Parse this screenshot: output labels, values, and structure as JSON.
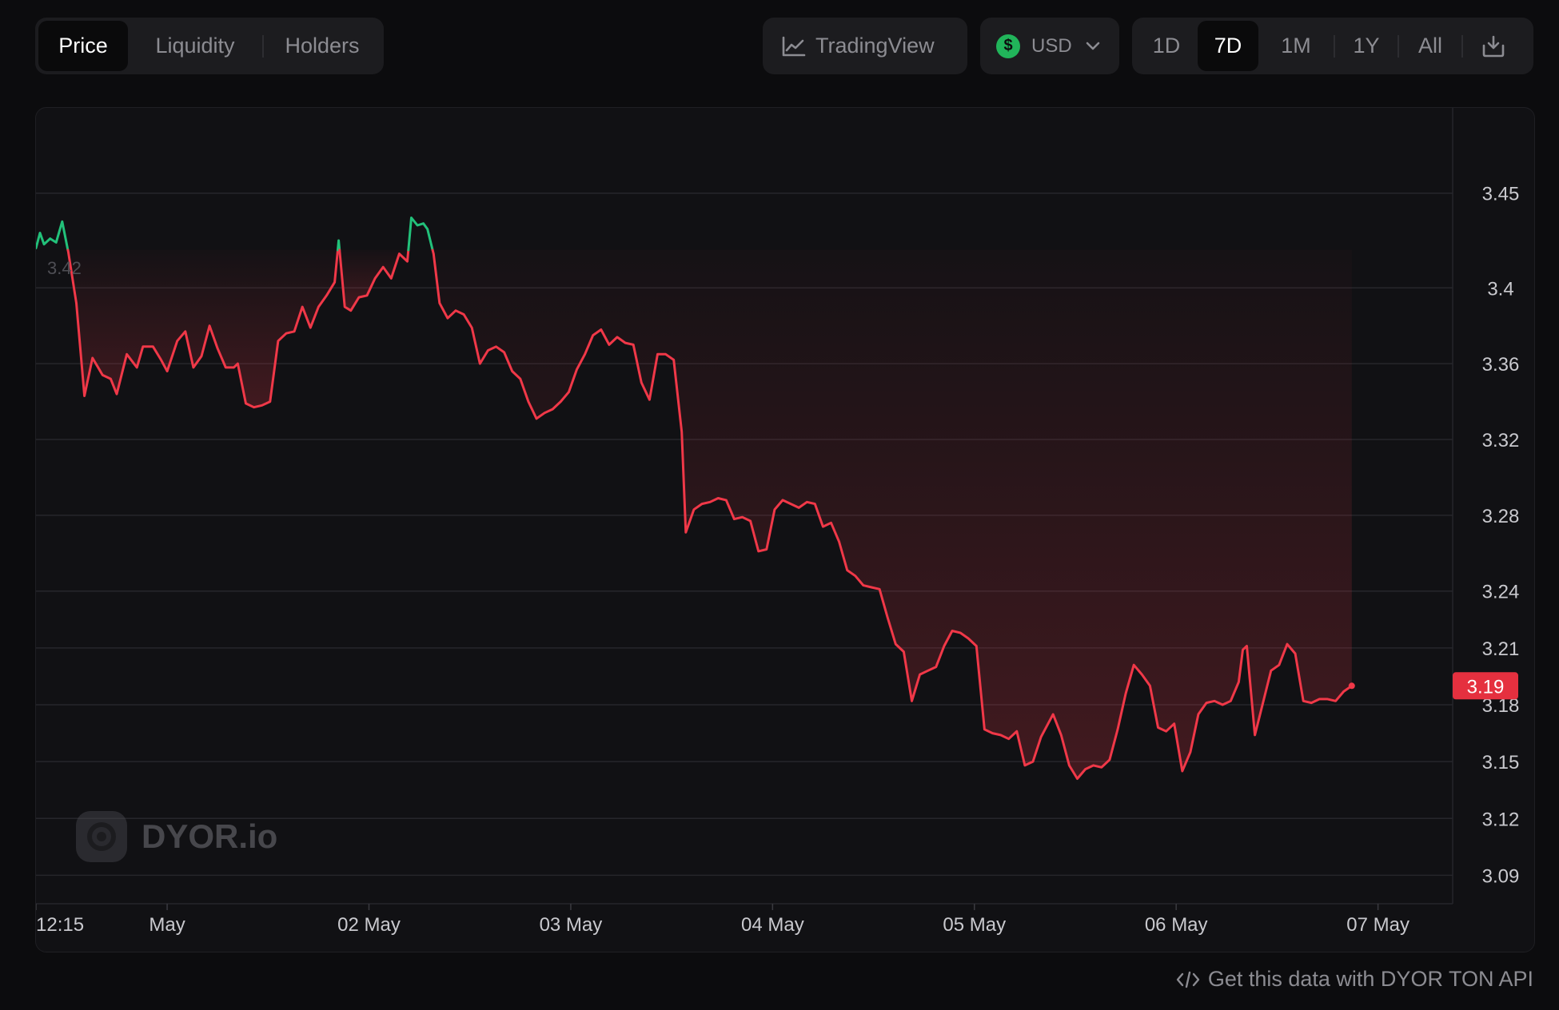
{
  "tabs": [
    {
      "label": "Price",
      "active": true
    },
    {
      "label": "Liquidity",
      "active": false
    },
    {
      "label": "Holders",
      "active": false
    }
  ],
  "tradingview": {
    "label": "TradingView",
    "icon": "line-chart-icon"
  },
  "currency": {
    "label": "USD",
    "icon": "dollar-icon",
    "symbol": "$",
    "chevron": "chevron-down-icon"
  },
  "ranges": [
    {
      "label": "1D",
      "active": false
    },
    {
      "label": "7D",
      "active": true
    },
    {
      "label": "1M",
      "active": false
    },
    {
      "label": "1Y",
      "active": false
    },
    {
      "label": "All",
      "active": false
    }
  ],
  "download": {
    "icon": "download-icon"
  },
  "watermark": {
    "text": "DYOR.io",
    "icon": "dyor-logo-icon"
  },
  "footer": {
    "text": "Get this data with DYOR TON API",
    "icon": "code-icon"
  },
  "colors": {
    "up": "#22c17a",
    "down": "#f03848",
    "badge": "#e5303f",
    "grid": "#26262b"
  },
  "chart_data": {
    "type": "area",
    "baseline": 3.42,
    "baseline_label": "3.42",
    "current": 3.19,
    "current_label": "3.19",
    "ylim": [
      3.075,
      3.495
    ],
    "yticks": [
      "3.45",
      "3.4",
      "3.36",
      "3.32",
      "3.28",
      "3.24",
      "3.21",
      "3.18",
      "3.15",
      "3.12",
      "3.09"
    ],
    "xticks": [
      {
        "t": 0,
        "label": "12:15"
      },
      {
        "t": 0.65,
        "label": "May"
      },
      {
        "t": 1.65,
        "label": "02 May"
      },
      {
        "t": 2.65,
        "label": "03 May"
      },
      {
        "t": 3.65,
        "label": "04 May"
      },
      {
        "t": 4.65,
        "label": "05 May"
      },
      {
        "t": 5.65,
        "label": "06 May"
      },
      {
        "t": 6.65,
        "label": "07 May"
      }
    ],
    "xlim": [
      0,
      7.02
    ],
    "points": [
      [
        0.0,
        3.421
      ],
      [
        0.02,
        3.429
      ],
      [
        0.04,
        3.423
      ],
      [
        0.07,
        3.426
      ],
      [
        0.1,
        3.424
      ],
      [
        0.13,
        3.435
      ],
      [
        0.16,
        3.419
      ],
      [
        0.2,
        3.392
      ],
      [
        0.24,
        3.343
      ],
      [
        0.28,
        3.363
      ],
      [
        0.33,
        3.354
      ],
      [
        0.37,
        3.352
      ],
      [
        0.4,
        3.344
      ],
      [
        0.45,
        3.365
      ],
      [
        0.5,
        3.358
      ],
      [
        0.53,
        3.369
      ],
      [
        0.58,
        3.369
      ],
      [
        0.62,
        3.362
      ],
      [
        0.65,
        3.356
      ],
      [
        0.7,
        3.372
      ],
      [
        0.74,
        3.377
      ],
      [
        0.78,
        3.358
      ],
      [
        0.82,
        3.364
      ],
      [
        0.86,
        3.38
      ],
      [
        0.9,
        3.368
      ],
      [
        0.94,
        3.358
      ],
      [
        0.98,
        3.358
      ],
      [
        1.0,
        3.36
      ],
      [
        1.04,
        3.339
      ],
      [
        1.08,
        3.337
      ],
      [
        1.12,
        3.338
      ],
      [
        1.16,
        3.34
      ],
      [
        1.2,
        3.372
      ],
      [
        1.24,
        3.376
      ],
      [
        1.28,
        3.377
      ],
      [
        1.32,
        3.39
      ],
      [
        1.36,
        3.379
      ],
      [
        1.4,
        3.39
      ],
      [
        1.44,
        3.396
      ],
      [
        1.48,
        3.403
      ],
      [
        1.5,
        3.425
      ],
      [
        1.53,
        3.39
      ],
      [
        1.56,
        3.388
      ],
      [
        1.6,
        3.395
      ],
      [
        1.64,
        3.396
      ],
      [
        1.68,
        3.405
      ],
      [
        1.72,
        3.411
      ],
      [
        1.76,
        3.405
      ],
      [
        1.8,
        3.418
      ],
      [
        1.84,
        3.414
      ],
      [
        1.86,
        3.437
      ],
      [
        1.89,
        3.433
      ],
      [
        1.92,
        3.434
      ],
      [
        1.94,
        3.431
      ],
      [
        1.97,
        3.418
      ],
      [
        2.0,
        3.392
      ],
      [
        2.04,
        3.384
      ],
      [
        2.08,
        3.388
      ],
      [
        2.12,
        3.386
      ],
      [
        2.16,
        3.379
      ],
      [
        2.2,
        3.36
      ],
      [
        2.24,
        3.367
      ],
      [
        2.28,
        3.369
      ],
      [
        2.32,
        3.366
      ],
      [
        2.36,
        3.356
      ],
      [
        2.4,
        3.352
      ],
      [
        2.44,
        3.34
      ],
      [
        2.48,
        3.331
      ],
      [
        2.52,
        3.334
      ],
      [
        2.56,
        3.336
      ],
      [
        2.6,
        3.34
      ],
      [
        2.64,
        3.345
      ],
      [
        2.68,
        3.357
      ],
      [
        2.72,
        3.365
      ],
      [
        2.76,
        3.375
      ],
      [
        2.8,
        3.378
      ],
      [
        2.84,
        3.37
      ],
      [
        2.88,
        3.374
      ],
      [
        2.92,
        3.371
      ],
      [
        2.96,
        3.37
      ],
      [
        3.0,
        3.35
      ],
      [
        3.04,
        3.341
      ],
      [
        3.08,
        3.365
      ],
      [
        3.12,
        3.365
      ],
      [
        3.16,
        3.362
      ],
      [
        3.2,
        3.324
      ],
      [
        3.22,
        3.271
      ],
      [
        3.26,
        3.283
      ],
      [
        3.3,
        3.286
      ],
      [
        3.34,
        3.287
      ],
      [
        3.38,
        3.289
      ],
      [
        3.42,
        3.288
      ],
      [
        3.46,
        3.278
      ],
      [
        3.5,
        3.279
      ],
      [
        3.54,
        3.277
      ],
      [
        3.58,
        3.261
      ],
      [
        3.62,
        3.262
      ],
      [
        3.66,
        3.283
      ],
      [
        3.7,
        3.288
      ],
      [
        3.74,
        3.286
      ],
      [
        3.78,
        3.284
      ],
      [
        3.82,
        3.287
      ],
      [
        3.86,
        3.286
      ],
      [
        3.9,
        3.274
      ],
      [
        3.94,
        3.276
      ],
      [
        3.98,
        3.266
      ],
      [
        4.02,
        3.251
      ],
      [
        4.06,
        3.248
      ],
      [
        4.1,
        3.243
      ],
      [
        4.14,
        3.242
      ],
      [
        4.18,
        3.241
      ],
      [
        4.22,
        3.226
      ],
      [
        4.26,
        3.212
      ],
      [
        4.3,
        3.208
      ],
      [
        4.34,
        3.182
      ],
      [
        4.38,
        3.196
      ],
      [
        4.42,
        3.198
      ],
      [
        4.46,
        3.2
      ],
      [
        4.5,
        3.211
      ],
      [
        4.54,
        3.219
      ],
      [
        4.58,
        3.218
      ],
      [
        4.62,
        3.215
      ],
      [
        4.66,
        3.211
      ],
      [
        4.7,
        3.167
      ],
      [
        4.74,
        3.165
      ],
      [
        4.78,
        3.164
      ],
      [
        4.82,
        3.162
      ],
      [
        4.86,
        3.166
      ],
      [
        4.9,
        3.148
      ],
      [
        4.94,
        3.15
      ],
      [
        4.98,
        3.163
      ],
      [
        5.02,
        3.171
      ],
      [
        5.04,
        3.175
      ],
      [
        5.08,
        3.164
      ],
      [
        5.12,
        3.148
      ],
      [
        5.16,
        3.141
      ],
      [
        5.2,
        3.146
      ],
      [
        5.24,
        3.148
      ],
      [
        5.28,
        3.147
      ],
      [
        5.32,
        3.151
      ],
      [
        5.36,
        3.167
      ],
      [
        5.4,
        3.186
      ],
      [
        5.44,
        3.201
      ],
      [
        5.48,
        3.196
      ],
      [
        5.52,
        3.19
      ],
      [
        5.56,
        3.168
      ],
      [
        5.6,
        3.166
      ],
      [
        5.64,
        3.17
      ],
      [
        5.68,
        3.145
      ],
      [
        5.72,
        3.155
      ],
      [
        5.76,
        3.175
      ],
      [
        5.8,
        3.181
      ],
      [
        5.84,
        3.182
      ],
      [
        5.88,
        3.18
      ],
      [
        5.92,
        3.182
      ],
      [
        5.96,
        3.192
      ],
      [
        5.98,
        3.209
      ],
      [
        6.0,
        3.211
      ],
      [
        6.04,
        3.164
      ],
      [
        6.08,
        3.181
      ],
      [
        6.12,
        3.198
      ],
      [
        6.16,
        3.201
      ],
      [
        6.2,
        3.212
      ],
      [
        6.24,
        3.207
      ],
      [
        6.28,
        3.182
      ],
      [
        6.32,
        3.181
      ],
      [
        6.36,
        3.183
      ],
      [
        6.4,
        3.183
      ],
      [
        6.44,
        3.182
      ],
      [
        6.48,
        3.187
      ],
      [
        6.52,
        3.19
      ]
    ]
  }
}
